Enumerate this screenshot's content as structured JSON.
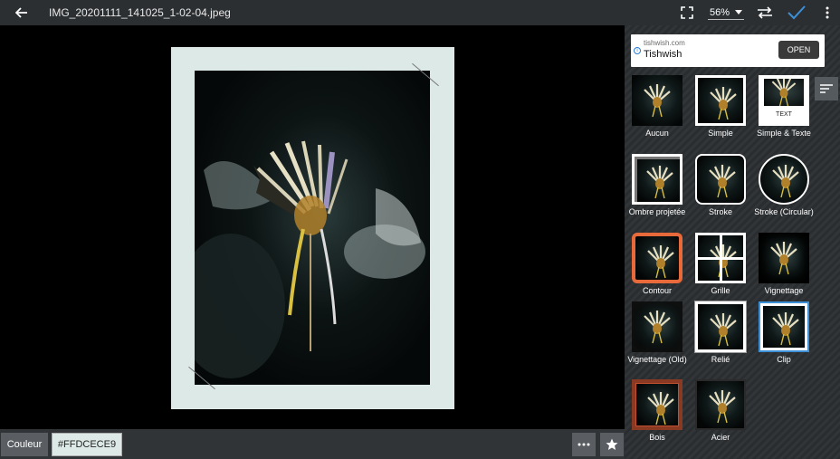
{
  "header": {
    "title": "IMG_20201111_141025_1-02-04.jpeg",
    "zoom": "56%"
  },
  "ad": {
    "domain": "tishwish.com",
    "name": "Tishwish",
    "cta": "OPEN",
    "info_glyph": "i"
  },
  "frames": [
    {
      "label": "Aucun",
      "icon": "frame-none"
    },
    {
      "label": "Simple",
      "icon": "frame-simple"
    },
    {
      "label": "Simple & Texte",
      "icon": "frame-simple-text",
      "caption": "TEXT"
    },
    {
      "label": "Ombre projetée",
      "icon": "frame-shadow"
    },
    {
      "label": "Stroke",
      "icon": "frame-stroke"
    },
    {
      "label": "Stroke (Circular)",
      "icon": "frame-stroke-circular"
    },
    {
      "label": "Contour",
      "icon": "frame-contour",
      "selected": true
    },
    {
      "label": "Grille",
      "icon": "frame-grid"
    },
    {
      "label": "Vignettage",
      "icon": "frame-vignette"
    },
    {
      "label": "Vignettage (Old)",
      "icon": "frame-vignette-old"
    },
    {
      "label": "Relié",
      "icon": "frame-bound"
    },
    {
      "label": "Clip",
      "icon": "frame-clip"
    },
    {
      "label": "Bois",
      "icon": "frame-wood"
    },
    {
      "label": "Acier",
      "icon": "frame-steel"
    }
  ],
  "bottom": {
    "color_button": "Couleur",
    "color_value": "#FFDCECE9"
  },
  "colors": {
    "frame_color": "#dce9e6",
    "accent_orange": "#e8693a",
    "accent_blue": "#3d8fd6",
    "wood": "#8a3a22"
  }
}
